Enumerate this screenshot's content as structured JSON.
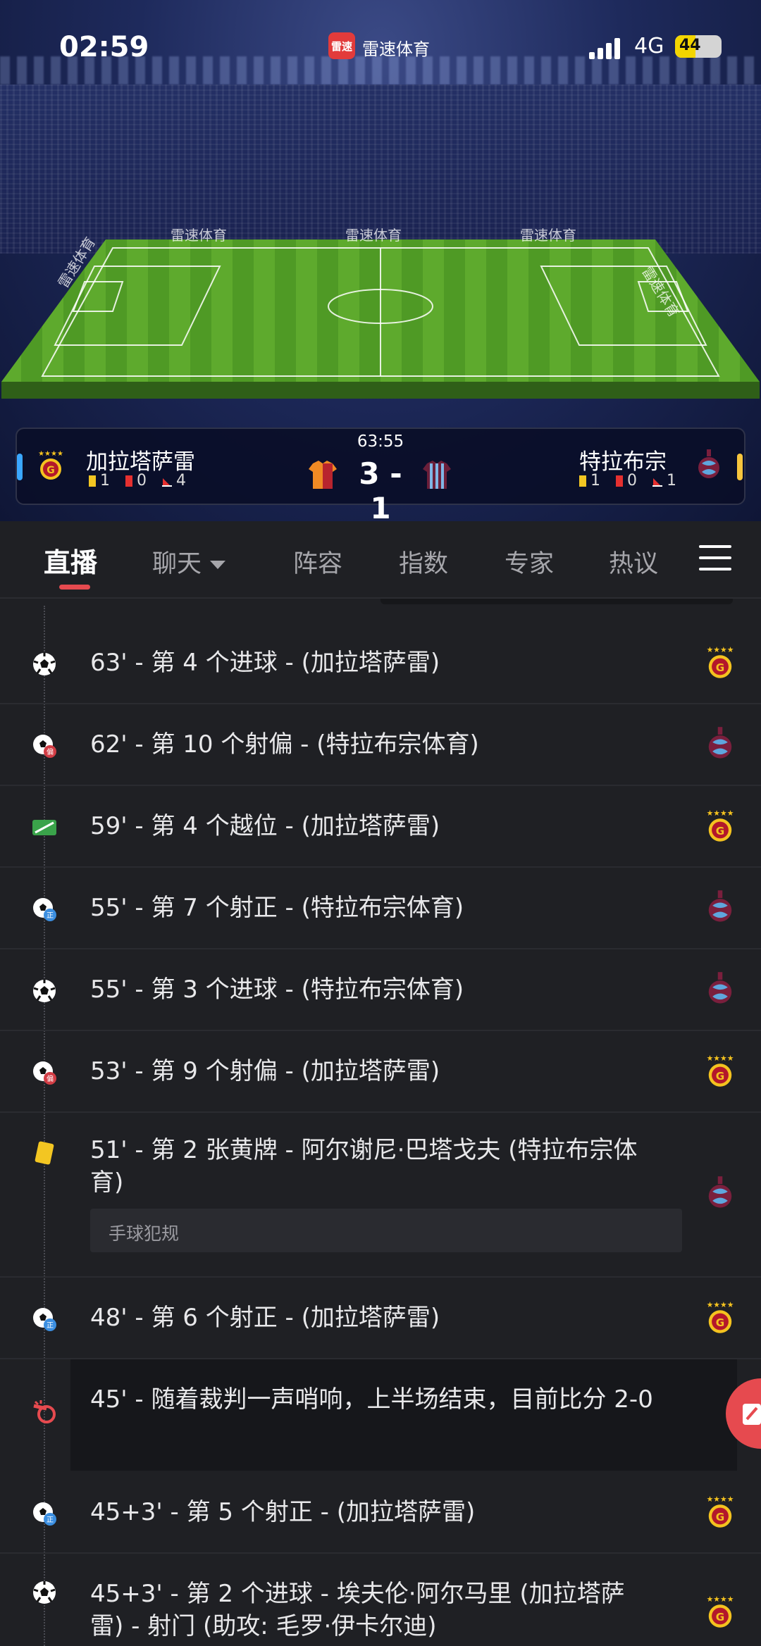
{
  "status_bar": {
    "time": "02:59",
    "app_name": "雷速体育",
    "app_logo_text": "雷速",
    "network": "4G",
    "battery": "44"
  },
  "stadium": {
    "banners": [
      "雷速体育",
      "雷速体育",
      "雷速体育",
      "雷速体育",
      "雷速体育"
    ]
  },
  "match": {
    "minute": "63:55",
    "score": "3 - 1",
    "home": {
      "name": "加拉塔萨雷",
      "yellow": "1",
      "red": "0",
      "corners": "4"
    },
    "away": {
      "name": "特拉布宗",
      "yellow": "1",
      "red": "0",
      "corners": "1"
    },
    "colors": {
      "home_primary": "#f08a24",
      "home_secondary": "#b8242e",
      "away_primary": "#6b1f3a",
      "away_secondary": "#7fb6e6"
    }
  },
  "tabs": {
    "items": [
      "直播",
      "聊天",
      "阵容",
      "指数",
      "专家",
      "热议"
    ],
    "active": "直播"
  },
  "events": [
    {
      "icon": "soccer-ball-icon",
      "text": "63' - 第 4 个进球 - (加拉塔萨雷)",
      "team": "home"
    },
    {
      "icon": "shot-off-target-icon",
      "text": "62' - 第 10 个射偏 - (特拉布宗体育)",
      "team": "away"
    },
    {
      "icon": "offside-icon",
      "text": "59' - 第 4 个越位 - (加拉塔萨雷)",
      "team": "home"
    },
    {
      "icon": "shot-on-target-icon",
      "text": "55' - 第 7 个射正 - (特拉布宗体育)",
      "team": "away"
    },
    {
      "icon": "soccer-ball-icon",
      "text": "55' - 第 3 个进球 - (特拉布宗体育)",
      "team": "away"
    },
    {
      "icon": "shot-off-target-icon",
      "text": "53' - 第 9 个射偏 - (加拉塔萨雷)",
      "team": "home"
    },
    {
      "icon": "yellow-card-icon",
      "text": "51' - 第 2 张黄牌 - 阿尔谢尼·巴塔戈夫 (特拉布宗体育)",
      "team": "away",
      "note": "手球犯规"
    },
    {
      "icon": "shot-on-target-icon",
      "text": "48' - 第 6 个射正 - (加拉塔萨雷)",
      "team": "home"
    },
    {
      "icon": "whistle-icon",
      "text": "45' - 随着裁判一声哨响，上半场结束，目前比分 2-0",
      "team": ""
    },
    {
      "icon": "shot-on-target-icon",
      "text": "45+3' - 第 5 个射正 - (加拉塔萨雷)",
      "team": "home"
    },
    {
      "icon": "soccer-ball-icon",
      "text": "45+3' - 第 2 个进球 - 埃夫伦·阿尔马里 (加拉塔萨雷) - 射门 (助攻: 毛罗·伊卡尔迪)",
      "team": "home"
    }
  ],
  "icon_badges": {
    "shot_off": "偏",
    "shot_on": "正"
  }
}
